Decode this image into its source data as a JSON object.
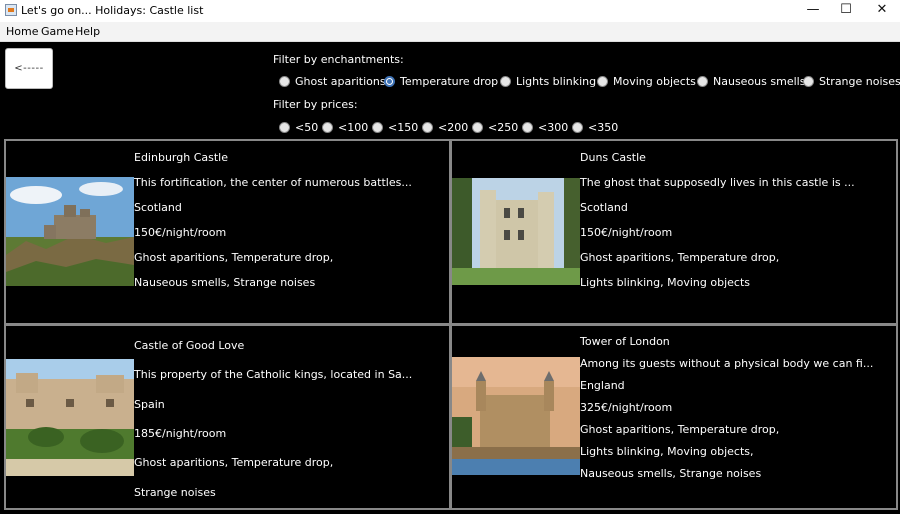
{
  "window": {
    "title": "Let's go on... Holidays: Castle list",
    "controls": {
      "minimize": "—",
      "maximize": "☐",
      "close": "✕"
    }
  },
  "menu": [
    "Home",
    "Game",
    "Help"
  ],
  "back_button": "<-----",
  "filters": {
    "enchantments_label": "Filter by enchantments:",
    "enchantments": [
      {
        "label": "Ghost aparitions",
        "selected": false
      },
      {
        "label": "Temperature drop",
        "selected": true
      },
      {
        "label": "Lights blinking",
        "selected": false
      },
      {
        "label": "Moving objects",
        "selected": false
      },
      {
        "label": "Nauseous smells",
        "selected": false
      },
      {
        "label": "Strange noises",
        "selected": false
      }
    ],
    "prices_label": "Filter by prices:",
    "prices": [
      {
        "label": "<50",
        "selected": false
      },
      {
        "label": "<100",
        "selected": false
      },
      {
        "label": "<150",
        "selected": false
      },
      {
        "label": "<200",
        "selected": false
      },
      {
        "label": "<250",
        "selected": false
      },
      {
        "label": "<300",
        "selected": false
      },
      {
        "label": "<350",
        "selected": false
      }
    ]
  },
  "castles": [
    {
      "name": "Edinburgh Castle",
      "description": "This fortification, the center of numerous battles...",
      "country": "Scotland",
      "price": "150€/night/room",
      "enchantments_line1": "Ghost aparitions, Temperature drop,",
      "enchantments_line2": "Nauseous smells, Strange noises"
    },
    {
      "name": "Duns Castle",
      "description": "The ghost that supposedly lives in this castle is ...",
      "country": "Scotland",
      "price": "150€/night/room",
      "enchantments_line1": "Ghost aparitions, Temperature drop,",
      "enchantments_line2": "Lights blinking, Moving objects"
    },
    {
      "name": "Castle of Good Love",
      "description": "This property of the Catholic kings, located in Sa...",
      "country": "Spain",
      "price": "185€/night/room",
      "enchantments_line1": "Ghost aparitions, Temperature drop,",
      "enchantments_line2": "Strange noises"
    },
    {
      "name": "Tower of London",
      "description": "Among its guests without a physical body we can fi...",
      "country": "England",
      "price": "325€/night/room",
      "enchantments_line1": "Ghost aparitions, Temperature drop,",
      "enchantments_line2": "Lights blinking, Moving objects,",
      "enchantments_line3": "Nauseous smells, Strange noises"
    }
  ]
}
